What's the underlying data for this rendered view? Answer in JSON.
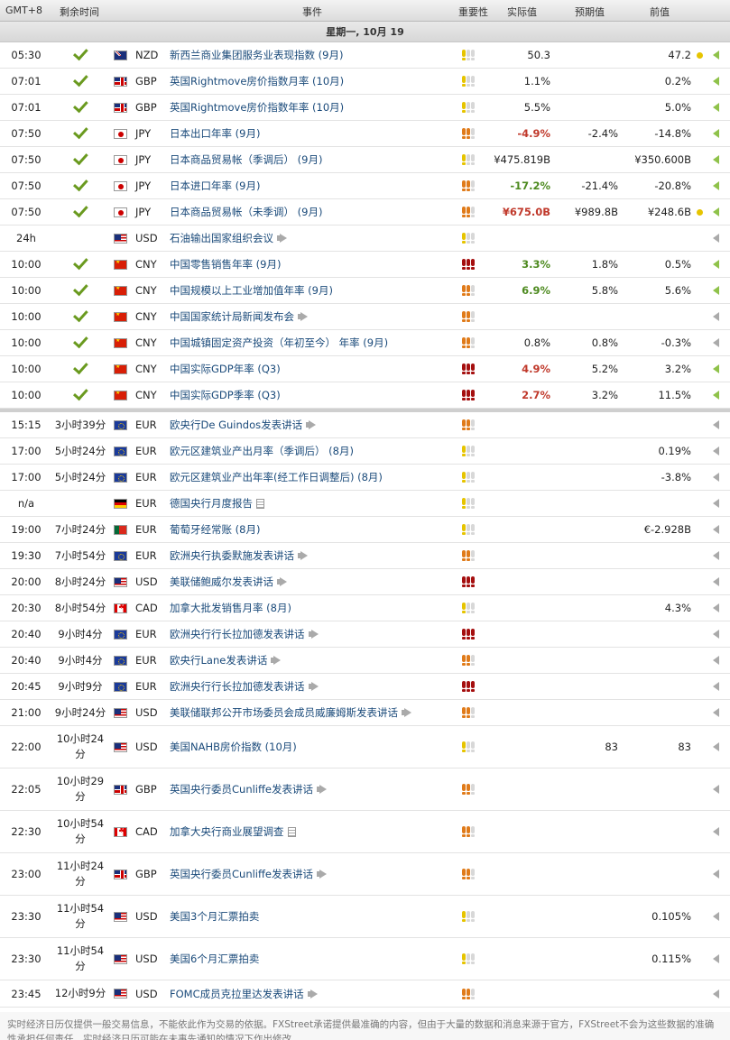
{
  "header": {
    "tz": "GMT+8",
    "remain": "剩余时间",
    "event": "事件",
    "importance": "重要性",
    "actual": "实际值",
    "forecast": "预期值",
    "previous": "前值"
  },
  "day_label": "星期一, 10月 19",
  "rows": [
    {
      "time": "05:30",
      "remain": "",
      "done": true,
      "flag": "nzd",
      "cur": "NZD",
      "event": "新西兰商业集团服务业表现指数 (9月)",
      "imp": "y1",
      "actual": "50.3",
      "actual_style": "",
      "forecast": "",
      "previous": "47.2",
      "dot": true,
      "arrow": "green",
      "icon": ""
    },
    {
      "time": "07:01",
      "remain": "",
      "done": true,
      "flag": "gbp",
      "cur": "GBP",
      "event": "英国Rightmove房价指数月率 (10月)",
      "imp": "y1",
      "actual": "1.1%",
      "actual_style": "",
      "forecast": "",
      "previous": "0.2%",
      "dot": false,
      "arrow": "green",
      "icon": ""
    },
    {
      "time": "07:01",
      "remain": "",
      "done": true,
      "flag": "gbp",
      "cur": "GBP",
      "event": "英国Rightmove房价指数年率 (10月)",
      "imp": "y1",
      "actual": "5.5%",
      "actual_style": "",
      "forecast": "",
      "previous": "5.0%",
      "dot": false,
      "arrow": "green",
      "icon": ""
    },
    {
      "time": "07:50",
      "remain": "",
      "done": true,
      "flag": "jpy",
      "cur": "JPY",
      "event": "日本出口年率 (9月)",
      "imp": "o2",
      "actual": "-4.9%",
      "actual_style": "red",
      "forecast": "-2.4%",
      "previous": "-14.8%",
      "dot": false,
      "arrow": "green",
      "icon": ""
    },
    {
      "time": "07:50",
      "remain": "",
      "done": true,
      "flag": "jpy",
      "cur": "JPY",
      "event": "日本商品贸易帐（季调后） (9月)",
      "imp": "y1",
      "actual": "¥475.819B",
      "actual_style": "",
      "forecast": "",
      "previous": "¥350.600B",
      "dot": false,
      "arrow": "green",
      "icon": ""
    },
    {
      "time": "07:50",
      "remain": "",
      "done": true,
      "flag": "jpy",
      "cur": "JPY",
      "event": "日本进口年率 (9月)",
      "imp": "o2",
      "actual": "-17.2%",
      "actual_style": "grn",
      "forecast": "-21.4%",
      "previous": "-20.8%",
      "dot": false,
      "arrow": "green",
      "icon": ""
    },
    {
      "time": "07:50",
      "remain": "",
      "done": true,
      "flag": "jpy",
      "cur": "JPY",
      "event": "日本商品贸易帐（未季调） (9月)",
      "imp": "o2",
      "actual": "¥675.0B",
      "actual_style": "red",
      "forecast": "¥989.8B",
      "previous": "¥248.6B",
      "dot": true,
      "arrow": "green",
      "icon": ""
    },
    {
      "time": "24h",
      "remain": "",
      "done": false,
      "flag": "usd",
      "cur": "USD",
      "event": "石油输出国家组织会议",
      "imp": "y1",
      "actual": "",
      "actual_style": "",
      "forecast": "",
      "previous": "",
      "dot": false,
      "arrow": "gray",
      "icon": "speech"
    },
    {
      "time": "10:00",
      "remain": "",
      "done": true,
      "flag": "cny",
      "cur": "CNY",
      "event": "中国零售销售年率 (9月)",
      "imp": "r3",
      "actual": "3.3%",
      "actual_style": "grn",
      "forecast": "1.8%",
      "previous": "0.5%",
      "dot": false,
      "arrow": "green",
      "icon": ""
    },
    {
      "time": "10:00",
      "remain": "",
      "done": true,
      "flag": "cny",
      "cur": "CNY",
      "event": "中国规模以上工业增加值年率 (9月)",
      "imp": "o2",
      "actual": "6.9%",
      "actual_style": "grn",
      "forecast": "5.8%",
      "previous": "5.6%",
      "dot": false,
      "arrow": "green",
      "icon": ""
    },
    {
      "time": "10:00",
      "remain": "",
      "done": true,
      "flag": "cny",
      "cur": "CNY",
      "event": "中国国家统计局新闻发布会",
      "imp": "o2",
      "actual": "",
      "actual_style": "",
      "forecast": "",
      "previous": "",
      "dot": false,
      "arrow": "gray",
      "icon": "speech"
    },
    {
      "time": "10:00",
      "remain": "",
      "done": true,
      "flag": "cny",
      "cur": "CNY",
      "event": "中国城镇固定资产投资（年初至今） 年率 (9月)",
      "imp": "o2",
      "actual": "0.8%",
      "actual_style": "",
      "forecast": "0.8%",
      "previous": "-0.3%",
      "dot": false,
      "arrow": "gray",
      "icon": ""
    },
    {
      "time": "10:00",
      "remain": "",
      "done": true,
      "flag": "cny",
      "cur": "CNY",
      "event": "中国实际GDP年率 (Q3)",
      "imp": "r3",
      "actual": "4.9%",
      "actual_style": "red",
      "forecast": "5.2%",
      "previous": "3.2%",
      "dot": false,
      "arrow": "green",
      "icon": ""
    },
    {
      "time": "10:00",
      "remain": "",
      "done": true,
      "flag": "cny",
      "cur": "CNY",
      "event": "中国实际GDP季率 (Q3)",
      "imp": "r3",
      "actual": "2.7%",
      "actual_style": "red",
      "forecast": "3.2%",
      "previous": "11.5%",
      "dot": false,
      "arrow": "green",
      "icon": ""
    },
    {
      "time": "15:15",
      "remain": "3小时39分",
      "done": false,
      "flag": "eur",
      "cur": "EUR",
      "event": "欧央行De Guindos发表讲话",
      "imp": "o2",
      "actual": "",
      "actual_style": "",
      "forecast": "",
      "previous": "",
      "dot": false,
      "arrow": "gray",
      "icon": "speech"
    },
    {
      "time": "17:00",
      "remain": "5小时24分",
      "done": false,
      "flag": "eur",
      "cur": "EUR",
      "event": "欧元区建筑业产出月率（季调后） (8月)",
      "imp": "y1",
      "actual": "",
      "actual_style": "",
      "forecast": "",
      "previous": "0.19%",
      "dot": false,
      "arrow": "gray",
      "icon": ""
    },
    {
      "time": "17:00",
      "remain": "5小时24分",
      "done": false,
      "flag": "eur",
      "cur": "EUR",
      "event": "欧元区建筑业产出年率(经工作日调整后) (8月)",
      "imp": "y1",
      "actual": "",
      "actual_style": "",
      "forecast": "",
      "previous": "-3.8%",
      "dot": false,
      "arrow": "gray",
      "icon": ""
    },
    {
      "time": "n/a",
      "remain": "",
      "done": false,
      "flag": "de",
      "cur": "EUR",
      "event": "德国央行月度报告",
      "imp": "y1",
      "actual": "",
      "actual_style": "",
      "forecast": "",
      "previous": "",
      "dot": false,
      "arrow": "gray",
      "icon": "doc"
    },
    {
      "time": "19:00",
      "remain": "7小时24分",
      "done": false,
      "flag": "pt",
      "cur": "EUR",
      "event": "葡萄牙经常账 (8月)",
      "imp": "y1",
      "actual": "",
      "actual_style": "",
      "forecast": "",
      "previous": "€-2.928B",
      "dot": false,
      "arrow": "gray",
      "icon": ""
    },
    {
      "time": "19:30",
      "remain": "7小时54分",
      "done": false,
      "flag": "eur",
      "cur": "EUR",
      "event": "欧洲央行执委默施发表讲话",
      "imp": "o2",
      "actual": "",
      "actual_style": "",
      "forecast": "",
      "previous": "",
      "dot": false,
      "arrow": "gray",
      "icon": "speech"
    },
    {
      "time": "20:00",
      "remain": "8小时24分",
      "done": false,
      "flag": "usd",
      "cur": "USD",
      "event": "美联储鲍威尔发表讲话",
      "imp": "r3",
      "actual": "",
      "actual_style": "",
      "forecast": "",
      "previous": "",
      "dot": false,
      "arrow": "gray",
      "icon": "speech"
    },
    {
      "time": "20:30",
      "remain": "8小时54分",
      "done": false,
      "flag": "cad",
      "cur": "CAD",
      "event": "加拿大批发销售月率 (8月)",
      "imp": "y1",
      "actual": "",
      "actual_style": "",
      "forecast": "",
      "previous": "4.3%",
      "dot": false,
      "arrow": "gray",
      "icon": ""
    },
    {
      "time": "20:40",
      "remain": "9小时4分",
      "done": false,
      "flag": "eur",
      "cur": "EUR",
      "event": "欧洲央行行长拉加德发表讲话",
      "imp": "r3",
      "actual": "",
      "actual_style": "",
      "forecast": "",
      "previous": "",
      "dot": false,
      "arrow": "gray",
      "icon": "speech"
    },
    {
      "time": "20:40",
      "remain": "9小时4分",
      "done": false,
      "flag": "eur",
      "cur": "EUR",
      "event": "欧央行Lane发表讲话",
      "imp": "o2",
      "actual": "",
      "actual_style": "",
      "forecast": "",
      "previous": "",
      "dot": false,
      "arrow": "gray",
      "icon": "speech"
    },
    {
      "time": "20:45",
      "remain": "9小时9分",
      "done": false,
      "flag": "eur",
      "cur": "EUR",
      "event": "欧洲央行行长拉加德发表讲话",
      "imp": "r3",
      "actual": "",
      "actual_style": "",
      "forecast": "",
      "previous": "",
      "dot": false,
      "arrow": "gray",
      "icon": "speech"
    },
    {
      "time": "21:00",
      "remain": "9小时24分",
      "done": false,
      "flag": "usd",
      "cur": "USD",
      "event": "美联储联邦公开市场委员会成员威廉姆斯发表讲话",
      "imp": "o2",
      "actual": "",
      "actual_style": "",
      "forecast": "",
      "previous": "",
      "dot": false,
      "arrow": "gray",
      "icon": "speech"
    },
    {
      "time": "22:00",
      "remain": "10小时24分",
      "done": false,
      "flag": "usd",
      "cur": "USD",
      "event": "美国NAHB房价指数 (10月)",
      "imp": "y1",
      "actual": "",
      "actual_style": "",
      "forecast": "83",
      "previous": "83",
      "dot": false,
      "arrow": "gray",
      "icon": ""
    },
    {
      "time": "22:05",
      "remain": "10小时29分",
      "done": false,
      "flag": "gbp",
      "cur": "GBP",
      "event": "英国央行委员Cunliffe发表讲话",
      "imp": "o2",
      "actual": "",
      "actual_style": "",
      "forecast": "",
      "previous": "",
      "dot": false,
      "arrow": "gray",
      "icon": "speech"
    },
    {
      "time": "22:30",
      "remain": "10小时54分",
      "done": false,
      "flag": "cad",
      "cur": "CAD",
      "event": "加拿大央行商业展望调查",
      "imp": "o2",
      "actual": "",
      "actual_style": "",
      "forecast": "",
      "previous": "",
      "dot": false,
      "arrow": "gray",
      "icon": "doc"
    },
    {
      "time": "23:00",
      "remain": "11小时24分",
      "done": false,
      "flag": "gbp",
      "cur": "GBP",
      "event": "英国央行委员Cunliffe发表讲话",
      "imp": "o2",
      "actual": "",
      "actual_style": "",
      "forecast": "",
      "previous": "",
      "dot": false,
      "arrow": "gray",
      "icon": "speech"
    },
    {
      "time": "23:30",
      "remain": "11小时54分",
      "done": false,
      "flag": "usd",
      "cur": "USD",
      "event": "美国3个月汇票拍卖",
      "imp": "y1",
      "actual": "",
      "actual_style": "",
      "forecast": "",
      "previous": "0.105%",
      "dot": false,
      "arrow": "gray",
      "icon": ""
    },
    {
      "time": "23:30",
      "remain": "11小时54分",
      "done": false,
      "flag": "usd",
      "cur": "USD",
      "event": "美国6个月汇票拍卖",
      "imp": "y1",
      "actual": "",
      "actual_style": "",
      "forecast": "",
      "previous": "0.115%",
      "dot": false,
      "arrow": "gray",
      "icon": ""
    },
    {
      "time": "23:45",
      "remain": "12小时9分",
      "done": false,
      "flag": "usd",
      "cur": "USD",
      "event": "FOMC成员克拉里达发表讲话",
      "imp": "o2",
      "actual": "",
      "actual_style": "",
      "forecast": "",
      "previous": "",
      "dot": false,
      "arrow": "gray",
      "icon": "speech"
    }
  ],
  "footer": "实时经济日历仅提供一般交易信息，不能依此作为交易的依据。FXStreet承诺提供最准确的内容，但由于大量的数据和消息来源于官方，FXStreet不会为这些数据的准确性承担任何责任。实时经济日历可能在未事先通知的情况下作出修改。"
}
